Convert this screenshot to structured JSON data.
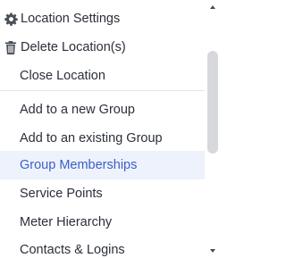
{
  "menu": {
    "items": [
      {
        "label": "Location Settings",
        "icon": "gear-icon"
      },
      {
        "label": "Delete Location(s)",
        "icon": "trash-icon"
      },
      {
        "label": "Close Location"
      },
      {
        "label": "Add to a new Group"
      },
      {
        "label": "Add to an existing Group"
      },
      {
        "label": "Group Memberships",
        "selected": true
      },
      {
        "label": "Service Points"
      },
      {
        "label": "Meter Hierarchy"
      },
      {
        "label": "Contacts & Logins"
      }
    ]
  },
  "colors": {
    "text": "#2b2f3a",
    "selected_text": "#3a5fc7",
    "selected_bg": "#eef2fc",
    "icon": "#4a4f59",
    "scroll_thumb": "#d6d8dc"
  }
}
